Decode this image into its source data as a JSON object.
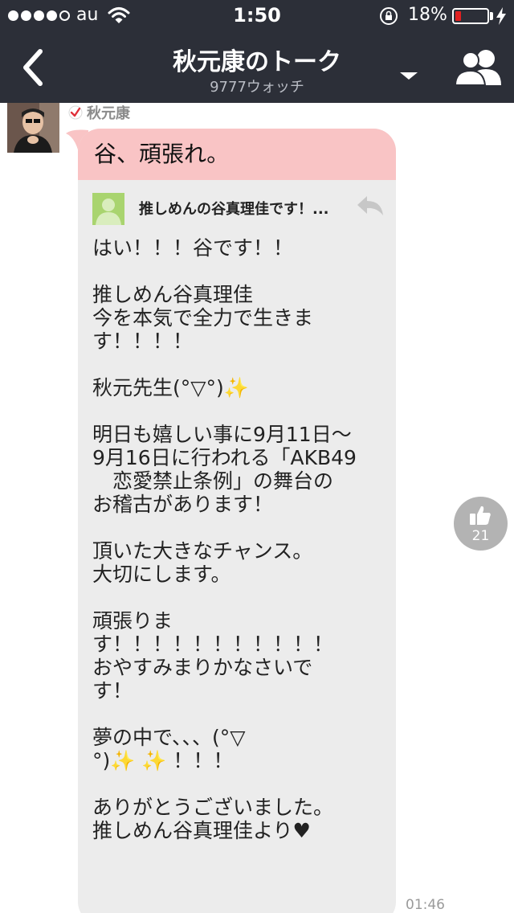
{
  "status_bar": {
    "carrier": "au",
    "time": "1:50",
    "battery_percent": "18%",
    "battery_level": 0.18
  },
  "nav": {
    "title": "秋元康のトーク",
    "subtitle": "9777ウォッチ"
  },
  "message": {
    "sender": "秋元康",
    "comment": "谷、頑張れ。",
    "quoted_title": "推しめんの谷真理佳です！...",
    "quoted_lines": [
      "はい！！！谷です！！",
      "",
      "推しめん谷真理佳",
      "今を本気で全力で生きま",
      "す！！！！",
      "",
      "秋元先生(°▽°)",
      "",
      "明日も嬉しい事に9月11日〜",
      "9月16日に行われる「AKB49",
      "　恋愛禁止条例」の舞台の",
      "お稽古があります！",
      "",
      "頂いた大きなチャンス。",
      "大切にします。",
      "",
      "頑張りま",
      "す！！！！！！！！！！！",
      "おやすみまりかなさいで",
      "す！",
      "",
      "夢の中で、、、(°▽",
      "°)",
      "",
      "ありがとうございました。",
      "推しめん谷真理佳より"
    ],
    "sparkle": "✨",
    "double_sparkle": "✨ ✨",
    "exclaim_tail": " ！！！",
    "heart": "♥",
    "like_count": "21",
    "timestamp": "01:46"
  },
  "colors": {
    "nav_bg": "#2c2f38",
    "comment_bg": "#f9c4c5",
    "bubble_bg": "#ececec",
    "battery_low": "#e02020"
  },
  "icons": [
    "back-chevron-icon",
    "dropdown-caret-icon",
    "members-icon",
    "verified-check-icon",
    "reply-icon",
    "thumbs-up-icon",
    "wifi-icon",
    "rotation-lock-icon",
    "charging-bolt-icon"
  ]
}
